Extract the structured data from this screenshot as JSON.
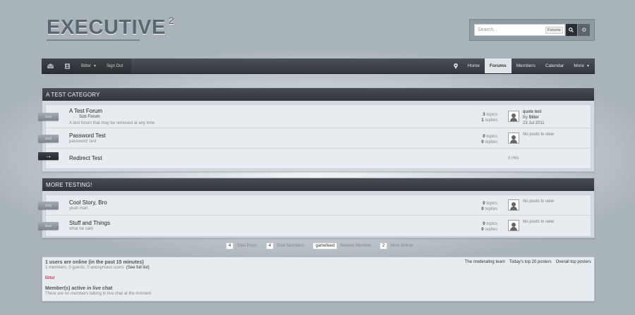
{
  "header": {
    "logo_text": "EXECUTIVE",
    "logo_sup": "2",
    "search_placeholder": "Search...",
    "search_scope": "Forums"
  },
  "nav": {
    "user": "Bitter",
    "sign_out": "Sign Out",
    "items": [
      "Home",
      "Forums",
      "Members",
      "Calendar",
      "More"
    ],
    "active": "Forums"
  },
  "categories": [
    {
      "title": "A TEST CATEGORY",
      "forums": [
        {
          "tag": "OLD",
          "title": "A Test Forum",
          "subforum": "Sub Forum",
          "description": "A test forum that may be removed at any time",
          "topics": "3",
          "topics_label": "topics",
          "replies": "1",
          "replies_label": "replies",
          "last_post_title": "quote test",
          "last_post_by_label": "By",
          "last_post_by": "Bitter",
          "last_post_date": "23 Jul 2011"
        },
        {
          "tag": "OLD",
          "title": "Password Test",
          "description": "password: test",
          "topics": "0",
          "topics_label": "topics",
          "replies": "0",
          "replies_label": "replies",
          "last_post_none": "No posts to view"
        },
        {
          "tag": "→",
          "title": "Redirect Test",
          "hits": "0 Hits"
        }
      ]
    },
    {
      "title": "MORE TESTING!",
      "forums": [
        {
          "tag": "OLD",
          "title": "Cool Story, Bro",
          "description": "yeah man.",
          "topics": "0",
          "topics_label": "topics",
          "replies": "0",
          "replies_label": "replies",
          "last_post_none": "No posts to view"
        },
        {
          "tag": "OLD",
          "title": "Stuff and Things",
          "description": "what he said",
          "topics": "0",
          "topics_label": "topics",
          "replies": "0",
          "replies_label": "replies",
          "last_post_none": "No posts to view"
        }
      ]
    }
  ],
  "stats": [
    {
      "value": "4",
      "label": "Total Posts"
    },
    {
      "value": "4",
      "label": "Total Members"
    },
    {
      "value": "gamefeed",
      "label": "Newest Member"
    },
    {
      "value": "2",
      "label": "Most Online"
    }
  ],
  "online": {
    "title": "1 users are online (in the past 15 minutes)",
    "counts": "1 members, 0 guests, 0 anonymous users",
    "full_list": "(See full list)",
    "user": "Bitter",
    "links": [
      "The moderating team",
      "Today's top 20 posters",
      "Overall top posters"
    ],
    "chat_title": "Member(s) active in live chat",
    "chat_sub": "There are no members talking in live chat at the moment"
  },
  "colors": {
    "nav_bg": "#32383d",
    "online_user": "#c0172b"
  }
}
